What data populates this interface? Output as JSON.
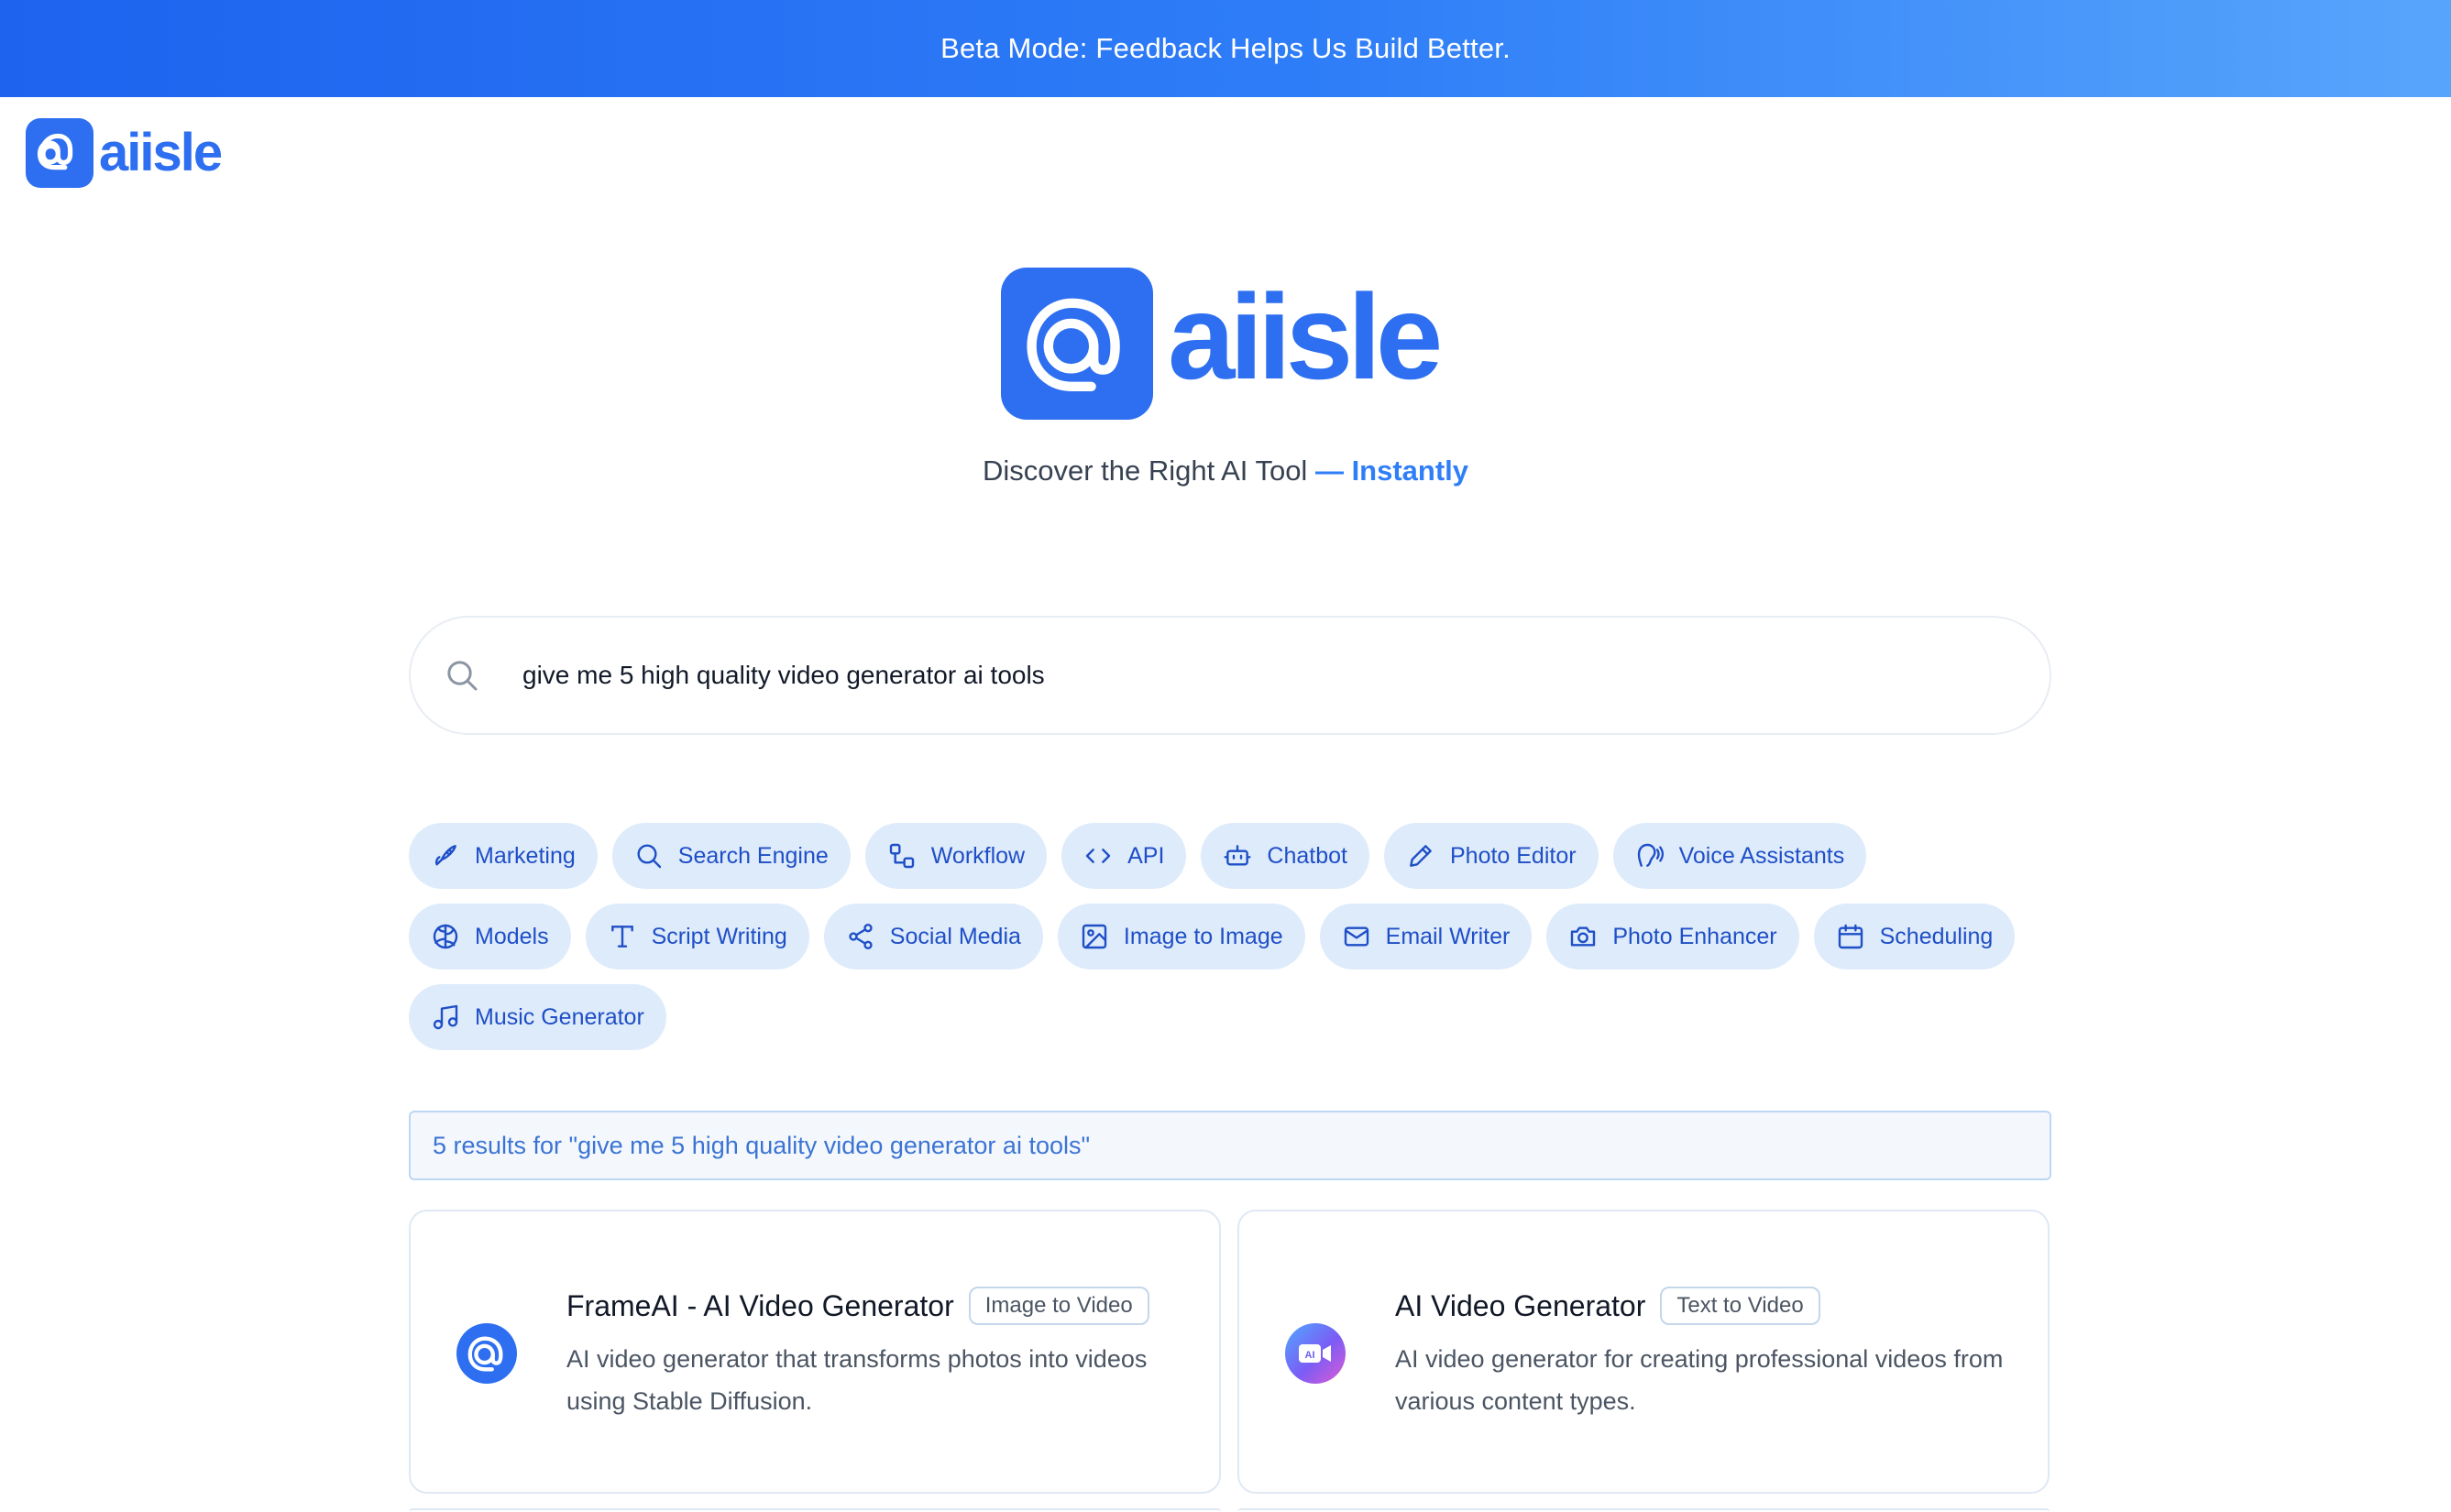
{
  "banner": {
    "text": "Beta Mode: Feedback Helps Us Build Better."
  },
  "brand": {
    "name": "aiisle",
    "mark": "@",
    "color": "#2d6ff0"
  },
  "hero": {
    "tagline_main": "Discover the Right AI Tool",
    "tagline_accent": "— Instantly"
  },
  "search": {
    "value": "give me 5 high quality video generator ai tools",
    "icon": "search-icon"
  },
  "categories": [
    [
      {
        "label": "Marketing",
        "icon": "rocket-icon"
      },
      {
        "label": "Search Engine",
        "icon": "search-icon"
      },
      {
        "label": "Workflow",
        "icon": "workflow-icon"
      },
      {
        "label": "API",
        "icon": "code-icon"
      },
      {
        "label": "Chatbot",
        "icon": "bot-icon"
      },
      {
        "label": "Photo Editor",
        "icon": "pencil-icon"
      },
      {
        "label": "Voice Assistants",
        "icon": "voice-icon"
      }
    ],
    [
      {
        "label": "Models",
        "icon": "brain-icon"
      },
      {
        "label": "Script Writing",
        "icon": "text-icon"
      },
      {
        "label": "Social Media",
        "icon": "share-icon"
      },
      {
        "label": "Image to Image",
        "icon": "image-icon"
      },
      {
        "label": "Email Writer",
        "icon": "mail-icon"
      },
      {
        "label": "Photo Enhancer",
        "icon": "camera-icon"
      },
      {
        "label": "Scheduling",
        "icon": "calendar-icon"
      }
    ],
    [
      {
        "label": "Music Generator",
        "icon": "music-icon"
      }
    ]
  ],
  "results": {
    "summary": "5 results for \"give me 5 high quality video generator ai tools\"",
    "cards": [
      {
        "title": "FrameAI - AI Video Generator",
        "tag": "Image to Video",
        "description": "AI video generator that transforms photos into videos using Stable Diffusion.",
        "icon": "frameai-logo-icon"
      },
      {
        "title": "AI Video Generator",
        "tag": "Text to Video",
        "description": "AI video generator for creating professional videos from various content types.",
        "icon": "ai-video-logo-icon"
      }
    ]
  }
}
